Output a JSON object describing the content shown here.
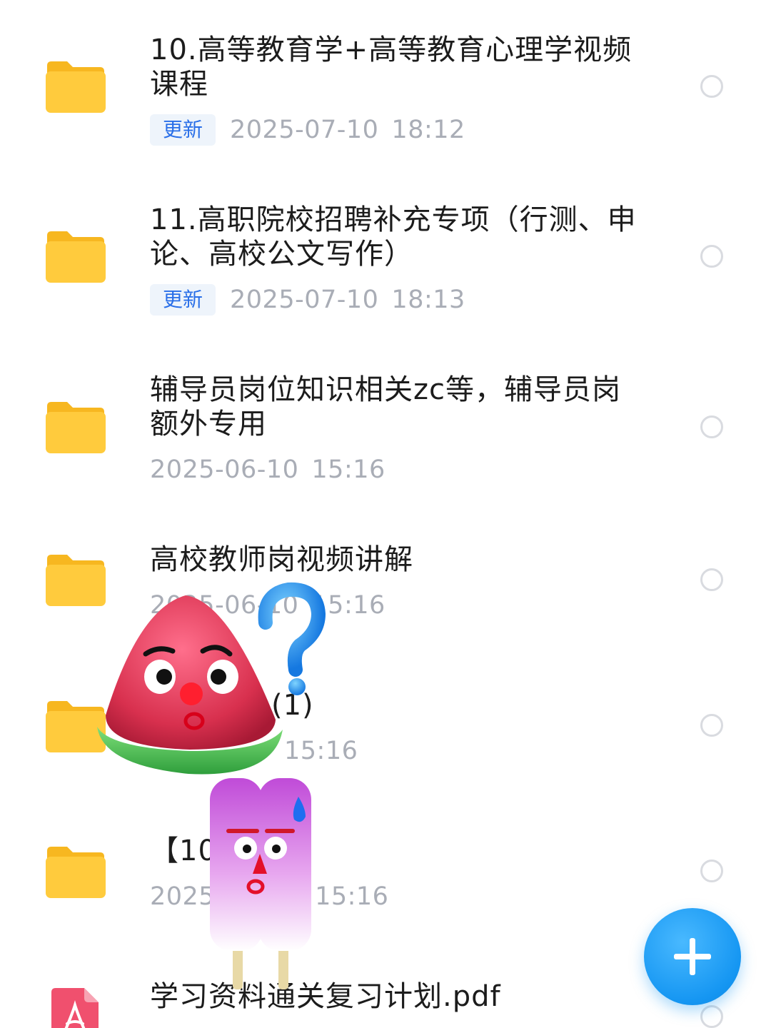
{
  "files": [
    {
      "name": "10.高等教育学+高等教育心理学视频课程",
      "badge": "更新",
      "date": "2025-07-10",
      "time": "18:12"
    },
    {
      "name": "11.高职院校招聘补充专项（行测、申论、高校公文写作）",
      "badge": "更新",
      "date": "2025-07-10",
      "time": "18:13"
    },
    {
      "name": "辅导员岗位知识相关zc等，辅导员岗额外专用",
      "badge": "",
      "date": "2025-06-10",
      "time": "15:16"
    },
    {
      "name": "高校教师岗视频讲解",
      "badge": "",
      "date": "2025-06-10",
      "time": "15:16"
    },
    {
      "name": "(1)",
      "badge": "",
      "date": "",
      "time": "15:16"
    },
    {
      "name": "【10】 点",
      "badge": "",
      "date": "2025",
      "time": "15:16"
    },
    {
      "name": "学习资料通关复习计划.pdf",
      "badge": "",
      "date": "",
      "time": ""
    }
  ],
  "icons": {
    "folder": "folder-icon",
    "pdf": "pdf-icon",
    "add": "plus-icon",
    "select": "radio-circle"
  },
  "colors": {
    "folder": "#FFC93C",
    "badge_bg": "#EEF4FB",
    "badge_text": "#2A6FE8",
    "date_text": "#A9ADB6",
    "fab": "#1596F2",
    "pdf": "#F0506E"
  }
}
